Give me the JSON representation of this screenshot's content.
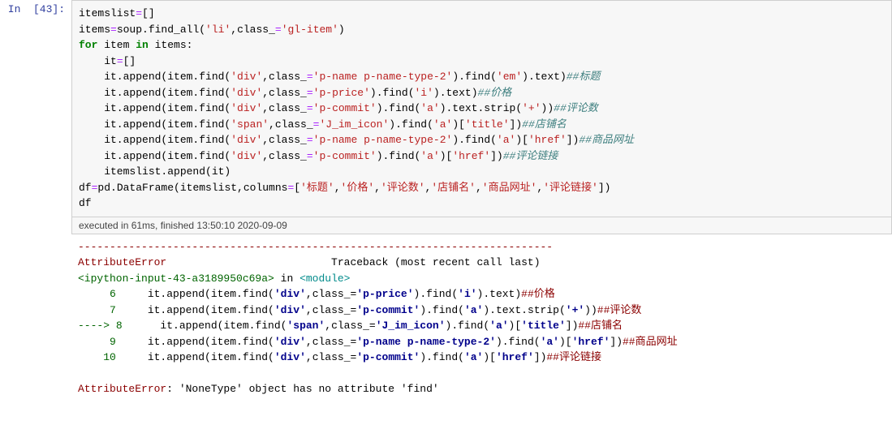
{
  "prompt": "In  [43]:",
  "code_lines": [
    [
      {
        "t": "itemslist",
        "c": "n"
      },
      {
        "t": "=",
        "c": "o"
      },
      {
        "t": "[]",
        "c": "p"
      }
    ],
    [
      {
        "t": "items",
        "c": "n"
      },
      {
        "t": "=",
        "c": "o"
      },
      {
        "t": "soup.find_all(",
        "c": "n"
      },
      {
        "t": "'li'",
        "c": "s"
      },
      {
        "t": ",class_",
        "c": "n"
      },
      {
        "t": "=",
        "c": "o"
      },
      {
        "t": "'gl-item'",
        "c": "s"
      },
      {
        "t": ")",
        "c": "p"
      }
    ],
    [
      {
        "t": "for",
        "c": "k"
      },
      {
        "t": " item ",
        "c": "n"
      },
      {
        "t": "in",
        "c": "k"
      },
      {
        "t": " items:",
        "c": "n"
      }
    ],
    [
      {
        "t": "    it",
        "c": "n"
      },
      {
        "t": "=",
        "c": "o"
      },
      {
        "t": "[]",
        "c": "p"
      }
    ],
    [
      {
        "t": "    it.append(item.find(",
        "c": "n"
      },
      {
        "t": "'div'",
        "c": "s"
      },
      {
        "t": ",class_",
        "c": "n"
      },
      {
        "t": "=",
        "c": "o"
      },
      {
        "t": "'p-name p-name-type-2'",
        "c": "s"
      },
      {
        "t": ").find(",
        "c": "n"
      },
      {
        "t": "'em'",
        "c": "s"
      },
      {
        "t": ").text)",
        "c": "n"
      },
      {
        "t": "##标题",
        "c": "c"
      }
    ],
    [
      {
        "t": "    it.append(item.find(",
        "c": "n"
      },
      {
        "t": "'div'",
        "c": "s"
      },
      {
        "t": ",class_",
        "c": "n"
      },
      {
        "t": "=",
        "c": "o"
      },
      {
        "t": "'p-price'",
        "c": "s"
      },
      {
        "t": ").find(",
        "c": "n"
      },
      {
        "t": "'i'",
        "c": "s"
      },
      {
        "t": ").text)",
        "c": "n"
      },
      {
        "t": "##价格",
        "c": "c"
      }
    ],
    [
      {
        "t": "    it.append(item.find(",
        "c": "n"
      },
      {
        "t": "'div'",
        "c": "s"
      },
      {
        "t": ",class_",
        "c": "n"
      },
      {
        "t": "=",
        "c": "o"
      },
      {
        "t": "'p-commit'",
        "c": "s"
      },
      {
        "t": ").find(",
        "c": "n"
      },
      {
        "t": "'a'",
        "c": "s"
      },
      {
        "t": ").text.strip(",
        "c": "n"
      },
      {
        "t": "'+'",
        "c": "s"
      },
      {
        "t": "))",
        "c": "n"
      },
      {
        "t": "##评论数",
        "c": "c"
      }
    ],
    [
      {
        "t": "    it.append(item.find(",
        "c": "n"
      },
      {
        "t": "'span'",
        "c": "s"
      },
      {
        "t": ",class_",
        "c": "n"
      },
      {
        "t": "=",
        "c": "o"
      },
      {
        "t": "'J_im_icon'",
        "c": "s"
      },
      {
        "t": ").find(",
        "c": "n"
      },
      {
        "t": "'a'",
        "c": "s"
      },
      {
        "t": ")[",
        "c": "n"
      },
      {
        "t": "'title'",
        "c": "s"
      },
      {
        "t": "])",
        "c": "n"
      },
      {
        "t": "##店铺名",
        "c": "c"
      }
    ],
    [
      {
        "t": "    it.append(item.find(",
        "c": "n"
      },
      {
        "t": "'div'",
        "c": "s"
      },
      {
        "t": ",class_",
        "c": "n"
      },
      {
        "t": "=",
        "c": "o"
      },
      {
        "t": "'p-name p-name-type-2'",
        "c": "s"
      },
      {
        "t": ").find(",
        "c": "n"
      },
      {
        "t": "'a'",
        "c": "s"
      },
      {
        "t": ")[",
        "c": "n"
      },
      {
        "t": "'href'",
        "c": "s"
      },
      {
        "t": "])",
        "c": "n"
      },
      {
        "t": "##商品网址",
        "c": "c"
      }
    ],
    [
      {
        "t": "    it.append(item.find(",
        "c": "n"
      },
      {
        "t": "'div'",
        "c": "s"
      },
      {
        "t": ",class_",
        "c": "n"
      },
      {
        "t": "=",
        "c": "o"
      },
      {
        "t": "'p-commit'",
        "c": "s"
      },
      {
        "t": ").find(",
        "c": "n"
      },
      {
        "t": "'a'",
        "c": "s"
      },
      {
        "t": ")[",
        "c": "n"
      },
      {
        "t": "'href'",
        "c": "s"
      },
      {
        "t": "])",
        "c": "n"
      },
      {
        "t": "##评论链接",
        "c": "c"
      }
    ],
    [
      {
        "t": "    itemslist.append(it)",
        "c": "n"
      }
    ],
    [
      {
        "t": "df",
        "c": "n"
      },
      {
        "t": "=",
        "c": "o"
      },
      {
        "t": "pd.DataFrame(itemslist,columns",
        "c": "n"
      },
      {
        "t": "=",
        "c": "o"
      },
      {
        "t": "[",
        "c": "p"
      },
      {
        "t": "'标题'",
        "c": "s"
      },
      {
        "t": ",",
        "c": "p"
      },
      {
        "t": "'价格'",
        "c": "s"
      },
      {
        "t": ",",
        "c": "p"
      },
      {
        "t": "'评论数'",
        "c": "s"
      },
      {
        "t": ",",
        "c": "p"
      },
      {
        "t": "'店铺名'",
        "c": "s"
      },
      {
        "t": ",",
        "c": "p"
      },
      {
        "t": "'商品网址'",
        "c": "s"
      },
      {
        "t": ",",
        "c": "p"
      },
      {
        "t": "'评论链接'",
        "c": "s"
      },
      {
        "t": "])",
        "c": "p"
      }
    ],
    [
      {
        "t": "df",
        "c": "n"
      }
    ]
  ],
  "exec_info": "executed in 61ms, finished 13:50:10 2020-09-09",
  "traceback": {
    "dashes": "---------------------------------------------------------------------------",
    "err_name": "AttributeError",
    "tb_label": "                          Traceback (most recent call last)",
    "file": "<ipython-input-43-a3189950c69a>",
    "in_word": " in ",
    "module": "<module>",
    "lines": [
      {
        "arrow": "     ",
        "no": "6",
        "code": [
          {
            "t": "     it.append(item.find(",
            "c": "n"
          },
          {
            "t": "'div'",
            "c": "tb-blue"
          },
          {
            "t": ",class_=",
            "c": "n"
          },
          {
            "t": "'p-price'",
            "c": "tb-blue"
          },
          {
            "t": ").find(",
            "c": "n"
          },
          {
            "t": "'i'",
            "c": "tb-blue"
          },
          {
            "t": ").text)",
            "c": "n"
          },
          {
            "t": "##价格",
            "c": "tb-red"
          }
        ]
      },
      {
        "arrow": "     ",
        "no": "7",
        "code": [
          {
            "t": "     it.append(item.find(",
            "c": "n"
          },
          {
            "t": "'div'",
            "c": "tb-blue"
          },
          {
            "t": ",class_=",
            "c": "n"
          },
          {
            "t": "'p-commit'",
            "c": "tb-blue"
          },
          {
            "t": ").find(",
            "c": "n"
          },
          {
            "t": "'a'",
            "c": "tb-blue"
          },
          {
            "t": ").text.strip(",
            "c": "n"
          },
          {
            "t": "'+'",
            "c": "tb-blue"
          },
          {
            "t": "))",
            "c": "n"
          },
          {
            "t": "##评论数",
            "c": "tb-red"
          }
        ]
      },
      {
        "arrow": "----> ",
        "no": "8",
        "code": [
          {
            "t": "      it.append(item.find(",
            "c": "n"
          },
          {
            "t": "'span'",
            "c": "tb-blue"
          },
          {
            "t": ",class_=",
            "c": "n"
          },
          {
            "t": "'J_im_icon'",
            "c": "tb-blue"
          },
          {
            "t": ").find(",
            "c": "n"
          },
          {
            "t": "'a'",
            "c": "tb-blue"
          },
          {
            "t": ")[",
            "c": "n"
          },
          {
            "t": "'title'",
            "c": "tb-blue"
          },
          {
            "t": "])",
            "c": "n"
          },
          {
            "t": "##店铺名",
            "c": "tb-red"
          }
        ]
      },
      {
        "arrow": "     ",
        "no": "9",
        "code": [
          {
            "t": "     it.append(item.find(",
            "c": "n"
          },
          {
            "t": "'div'",
            "c": "tb-blue"
          },
          {
            "t": ",class_=",
            "c": "n"
          },
          {
            "t": "'p-name p-name-type-2'",
            "c": "tb-blue"
          },
          {
            "t": ").find(",
            "c": "n"
          },
          {
            "t": "'a'",
            "c": "tb-blue"
          },
          {
            "t": ")[",
            "c": "n"
          },
          {
            "t": "'href'",
            "c": "tb-blue"
          },
          {
            "t": "])",
            "c": "n"
          },
          {
            "t": "##商品网址",
            "c": "tb-red"
          }
        ]
      },
      {
        "arrow": "    ",
        "no": "10",
        "code": [
          {
            "t": "     it.append(item.find(",
            "c": "n"
          },
          {
            "t": "'div'",
            "c": "tb-blue"
          },
          {
            "t": ",class_=",
            "c": "n"
          },
          {
            "t": "'p-commit'",
            "c": "tb-blue"
          },
          {
            "t": ").find(",
            "c": "n"
          },
          {
            "t": "'a'",
            "c": "tb-blue"
          },
          {
            "t": ")[",
            "c": "n"
          },
          {
            "t": "'href'",
            "c": "tb-blue"
          },
          {
            "t": "])",
            "c": "n"
          },
          {
            "t": "##评论链接",
            "c": "tb-red"
          }
        ]
      }
    ],
    "final_err": "AttributeError",
    "final_msg": ": 'NoneType' object has no attribute 'find'"
  }
}
